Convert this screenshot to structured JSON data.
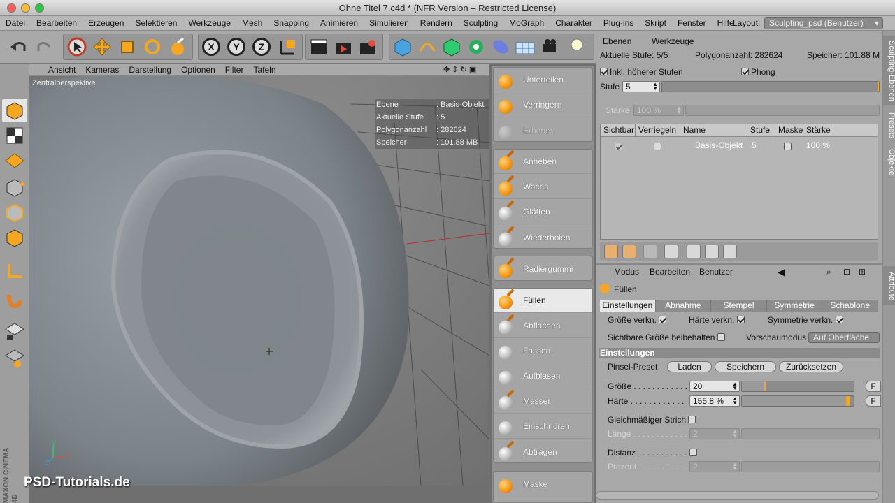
{
  "window": {
    "title": "Ohne Titel 7.c4d * (NFR Version – Restricted License)"
  },
  "menubar": {
    "items": [
      "Datei",
      "Bearbeiten",
      "Erzeugen",
      "Selektieren",
      "Werkzeuge",
      "Mesh",
      "Snapping",
      "Animieren",
      "Simulieren",
      "Rendern",
      "Sculpting",
      "MoGraph",
      "Charakter",
      "Plug-ins",
      "Skript",
      "Fenster",
      "Hilfe"
    ],
    "layout_label": "Layout:",
    "layout_value": "Sculpting_psd (Benutzer)"
  },
  "toolbar": {
    "axis_x": "X",
    "axis_y": "Y",
    "axis_z": "Z"
  },
  "viewport": {
    "menu": [
      "Ansicht",
      "Kameras",
      "Darstellung",
      "Optionen",
      "Filter",
      "Tafeln"
    ],
    "camera_label": "Zentralperspektive",
    "hud": [
      {
        "k": "Ebene",
        "v": "Basis-Objekt"
      },
      {
        "k": "Aktuelle Stufe",
        "v": "5"
      },
      {
        "k": "Polygonanzahl",
        "v": "282624"
      },
      {
        "k": "Speicher",
        "v": "101.88 MB"
      }
    ],
    "axis": {
      "x": "X",
      "y": "Y",
      "z": "Z"
    },
    "watermark": "PSD-Tutorials.de",
    "maxon": "MAXON CINEMA 4D"
  },
  "brushes": {
    "group1": [
      "Unterteilen",
      "Verringern",
      "Erhöhen"
    ],
    "group2": [
      "Anheben",
      "Wachs",
      "Glätten",
      "Wiederholen"
    ],
    "group3": [
      "Radiergummi"
    ],
    "group4": [
      "Füllen",
      "Abflachen",
      "Fassen",
      "Aufblasen",
      "Messer",
      "Einschnüren",
      "Abtragen"
    ],
    "group5": [
      "Maske"
    ]
  },
  "layers_panel": {
    "tabs": [
      "Ebenen",
      "Werkzeuge"
    ],
    "stage_label": "Aktuelle Stufe: 5/5",
    "poly_label": "Polygonanzahl: 282624",
    "mem_label": "Speicher: 101.88 M",
    "incl_label": "Inkl. höherer Stufen",
    "phong_label": "Phong",
    "stufe_label": "Stufe",
    "stufe_value": "5",
    "staerke_label": "Stärke",
    "staerke_value": "100 %",
    "columns": [
      "Sichtbar",
      "Verriegeln",
      "Name",
      "Stufe",
      "Maske",
      "Stärke"
    ],
    "row": {
      "name": "Basis-Objekt",
      "stufe": "5",
      "staerke": "100 %"
    }
  },
  "side_tabs": {
    "sculpting": "Sculpting-Ebenen",
    "presets": "Presets",
    "objekte": "Objekte",
    "attribute": "Attribute"
  },
  "attributes": {
    "menu": [
      "Modus",
      "Bearbeiten",
      "Benutzer"
    ],
    "tool_name": "Füllen",
    "tabs": [
      "Einstellungen",
      "Abnahme",
      "Stempel",
      "Symmetrie",
      "Schablone"
    ],
    "size_rel": "Größe verkn.",
    "hard_rel": "Härte verkn.",
    "sym_rel": "Symmetrie verkn.",
    "keep_size": "Sichtbare Größe beibehalten",
    "preview_label": "Vorschaumodus",
    "preview_value": "Auf Oberfläche",
    "section": "Einstellungen",
    "preset_label": "Pinsel-Preset",
    "btn_load": "Laden",
    "btn_save": "Speichern",
    "btn_reset": "Zurücksetzen",
    "size_label": "Größe . . . . . . . . . . . .",
    "size_value": "20",
    "size_fraction": 0.21,
    "hard_label": "Härte . . . . . . . . . . . .",
    "hard_value": "155.8 %",
    "hard_fraction": 0.97,
    "f_label": "F",
    "even_label": "Gleichmäßiger Strich",
    "len_label": "Länge . . . . . . . . . . . .",
    "len_value": "2",
    "dist_label": "Distanz . . . . . . . . . . .",
    "pct_label": "Prozent . . . . . . . . . . .",
    "pct_value": "2"
  }
}
